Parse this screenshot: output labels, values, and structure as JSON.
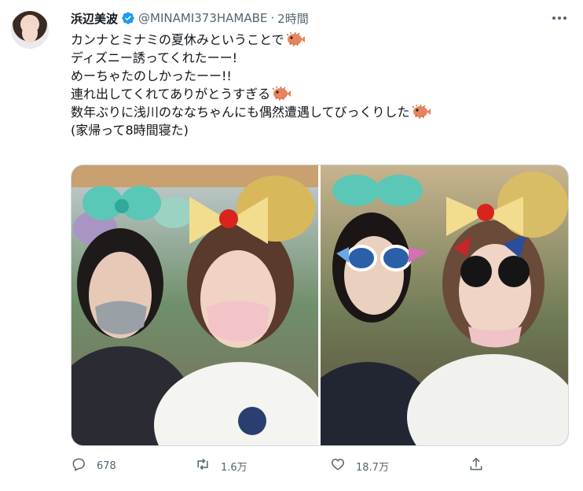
{
  "tweet": {
    "author_name": "浜辺美波",
    "handle": "@MINAMI373HAMABE",
    "separator": "·",
    "time": "2時間",
    "lines": [
      "カンナとミナミの夏休みということで",
      "ディズニー誘ってくれたーー!",
      "めーちゃたのしかったーー!!",
      "連れ出してくれてありがとうすぎる",
      "数年ぶりに浅川のななちゃんにも偶然遭遇してびっくりした",
      "(家帰って8時間寝た)"
    ],
    "emoji_name": "pufferfish-emoji"
  },
  "actions": {
    "reply_count": "678",
    "retweet_count": "1.6万",
    "like_count": "18.7万"
  },
  "icons": {
    "verified": "verified-badge-icon",
    "more": "more-options-icon",
    "reply": "reply-icon",
    "retweet": "retweet-icon",
    "like": "like-icon",
    "share": "share-icon"
  },
  "colors": {
    "verified_blue": "#1d9bf0",
    "text_primary": "#0f1419",
    "text_secondary": "#536471",
    "border": "#cfd9de"
  }
}
